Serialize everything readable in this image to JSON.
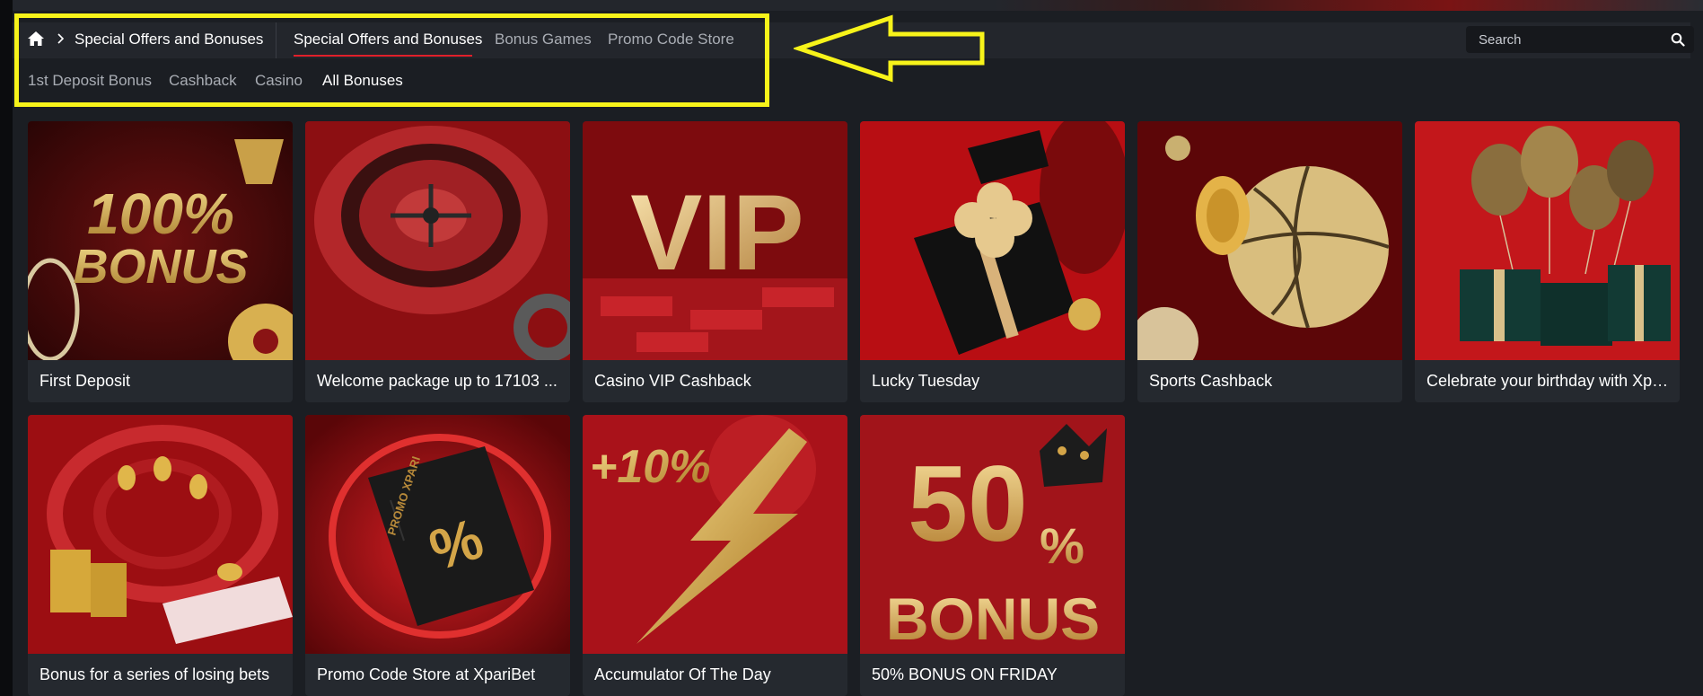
{
  "breadcrumb": {
    "home_icon": "home-icon",
    "label": "Special Offers and Bonuses"
  },
  "tabs": [
    {
      "label": "Special Offers and Bonuses",
      "active": true
    },
    {
      "label": "Bonus Games",
      "active": false
    },
    {
      "label": "Promo Code Store",
      "active": false
    }
  ],
  "subtabs": [
    {
      "label": "1st Deposit Bonus",
      "active": false
    },
    {
      "label": "Cashback",
      "active": false
    },
    {
      "label": "Casino",
      "active": false
    },
    {
      "label": "All Bonuses",
      "active": true
    }
  ],
  "search": {
    "placeholder": "Search",
    "icon": "search-icon"
  },
  "annotation": {
    "color": "#f7f31a"
  },
  "colors": {
    "accent": "#e0202a",
    "gold": "#d9b25a"
  },
  "cards": [
    {
      "title": "First Deposit",
      "image_text": [
        "100%",
        "BONUS"
      ]
    },
    {
      "title": "Welcome package up to 17103 ...",
      "image_text": []
    },
    {
      "title": "Casino VIP Cashback",
      "image_text": [
        "VIP"
      ]
    },
    {
      "title": "Lucky Tuesday",
      "image_text": []
    },
    {
      "title": "Sports Cashback",
      "image_text": []
    },
    {
      "title": "Celebrate your birthday with Xpar...",
      "image_text": []
    },
    {
      "title": "Bonus for a series of losing bets",
      "image_text": []
    },
    {
      "title": "Promo Code Store at XpariBet",
      "image_text": [
        "PROMO XPARI",
        "%"
      ]
    },
    {
      "title": "Accumulator Of The Day",
      "image_text": [
        "+10%"
      ]
    },
    {
      "title": "50% BONUS ON FRIDAY",
      "image_text": [
        "50",
        "%",
        "BONUS"
      ]
    }
  ]
}
